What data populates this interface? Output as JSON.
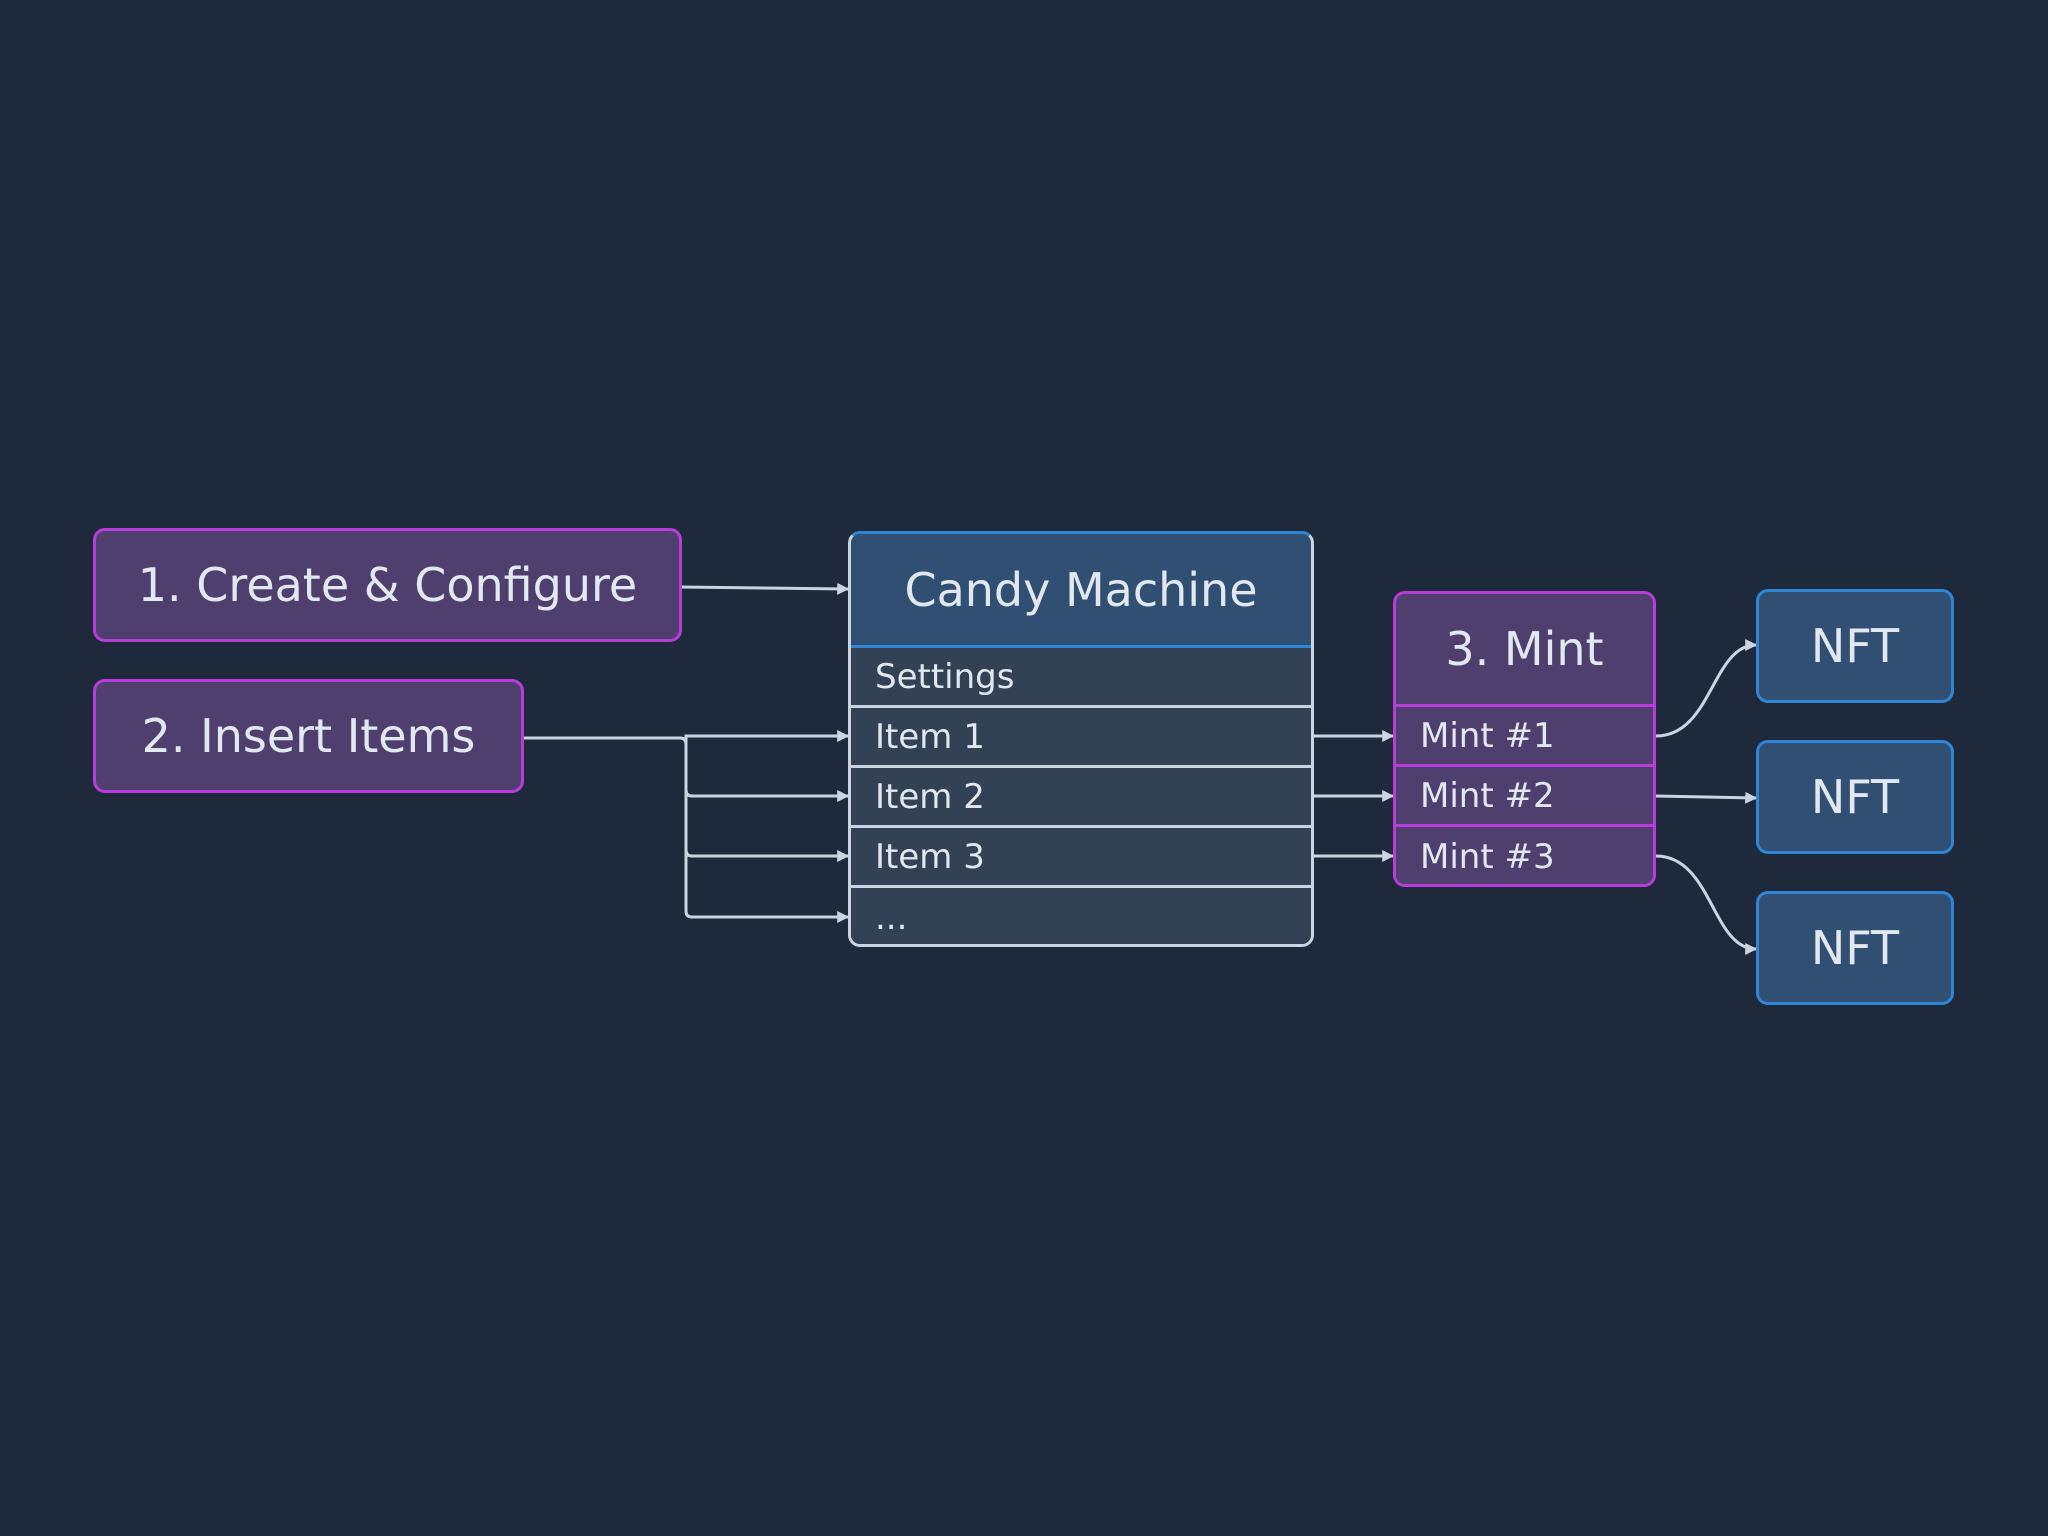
{
  "steps": {
    "create": "1. Create & Configure",
    "insert": "2. Insert Items",
    "mint": "3. Mint"
  },
  "candy_machine": {
    "title": "Candy Machine",
    "rows": [
      "Settings",
      "Item 1",
      "Item 2",
      "Item 3",
      "..."
    ]
  },
  "mints": [
    "Mint #1",
    "Mint #2",
    "Mint #3"
  ],
  "nfts": [
    "NFT",
    "NFT",
    "NFT"
  ],
  "colors": {
    "background": "#1e293b",
    "step_fill": "#4f3f6f",
    "step_border": "#b83cd9",
    "nft_fill": "#304f72",
    "nft_border": "#2f86d6",
    "table_fill": "#334155",
    "line": "#cbd5e1",
    "text": "#e2e8f0"
  }
}
